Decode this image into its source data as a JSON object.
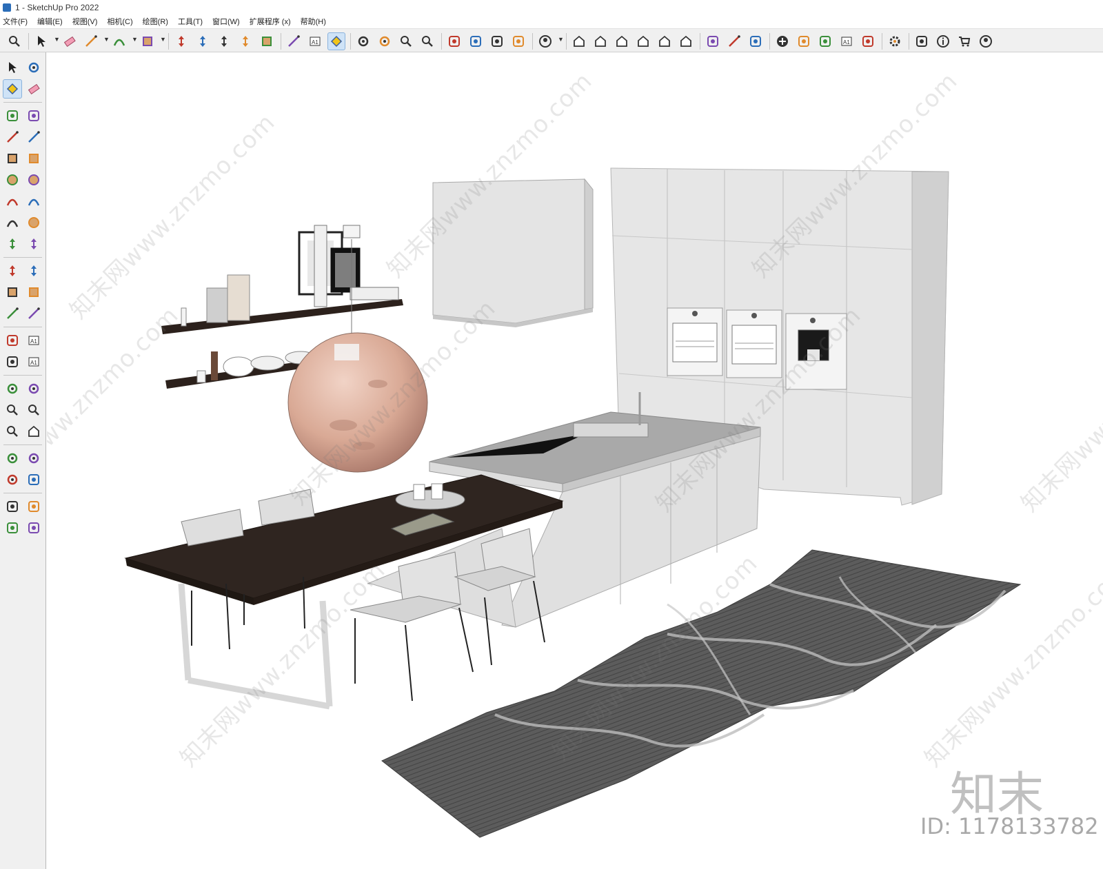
{
  "window": {
    "title": "1 - SketchUp Pro 2022"
  },
  "menu": [
    "文件(F)",
    "编辑(E)",
    "视图(V)",
    "相机(C)",
    "绘图(R)",
    "工具(T)",
    "窗口(W)",
    "扩展程序 (x)",
    "帮助(H)"
  ],
  "toolbar": {
    "tools": [
      "zoom-icon",
      "select-icon",
      "eraser-icon",
      "line-icon",
      "arc-icon",
      "rectangle-icon",
      "push-pull-icon",
      "follow-me-icon",
      "move-icon",
      "rotate-icon",
      "scale-icon",
      "tape-measure-icon",
      "text-icon",
      "paint-bucket-icon",
      "orbit-icon",
      "pan-icon",
      "zoom-window-icon",
      "zoom-extents-icon",
      "warehouse-icon",
      "extension-icon",
      "layers-icon",
      "section-icon",
      "user-account-icon",
      "iso-view-icon",
      "top-view-icon",
      "front-view-icon",
      "right-view-icon",
      "back-view-icon",
      "left-view-icon",
      "solid-tools-icon",
      "outliner-icon",
      "scenes-icon",
      "add-icon",
      "shield-icon",
      "style-icon",
      "texture-icon",
      "cloud-icon",
      "settings-icon",
      "comment-icon",
      "info-icon",
      "cart-icon",
      "profile-icon"
    ],
    "active_tool": "paint-bucket-icon"
  },
  "left_toolbar": {
    "tools": [
      "select-icon",
      "orbit-small-icon",
      "paint-bucket-icon",
      "eraser-icon",
      "component-icon",
      "tag-icon",
      "line-icon",
      "freehand-icon",
      "rectangle-icon",
      "rotated-rectangle-icon",
      "circle-icon",
      "polygon-icon",
      "arc-icon",
      "two-point-arc-icon",
      "three-point-arc-icon",
      "pie-icon",
      "move-icon",
      "push-pull-icon",
      "rotate-icon",
      "follow-me-icon",
      "scale-icon",
      "offset-icon",
      "tape-measure-icon",
      "dimension-icon",
      "protractor-icon",
      "text-icon",
      "axes-icon",
      "3d-text-icon",
      "orbit-icon",
      "pan-icon",
      "zoom-icon",
      "zoom-window-icon",
      "zoom-extents-icon",
      "previous-view-icon",
      "position-camera-icon",
      "look-around-icon",
      "walk-icon",
      "section-plane-icon",
      "warehouse-icon",
      "extension-warehouse-icon",
      "layout-icon",
      "sandbox-icon"
    ],
    "active_tool": "paint-bucket-icon"
  },
  "watermark": {
    "repeated_text": "知末网www.znzmo.com",
    "brand": "知末",
    "id_label": "ID: 1178133782"
  },
  "colors": {
    "accent": "#2b6db8",
    "active_tool_bg": "#cfe3f7",
    "cabinet": "#dedede",
    "table_top": "#2f2520",
    "rug": "#5a5a5a",
    "pendant": "#d9b0a0"
  }
}
